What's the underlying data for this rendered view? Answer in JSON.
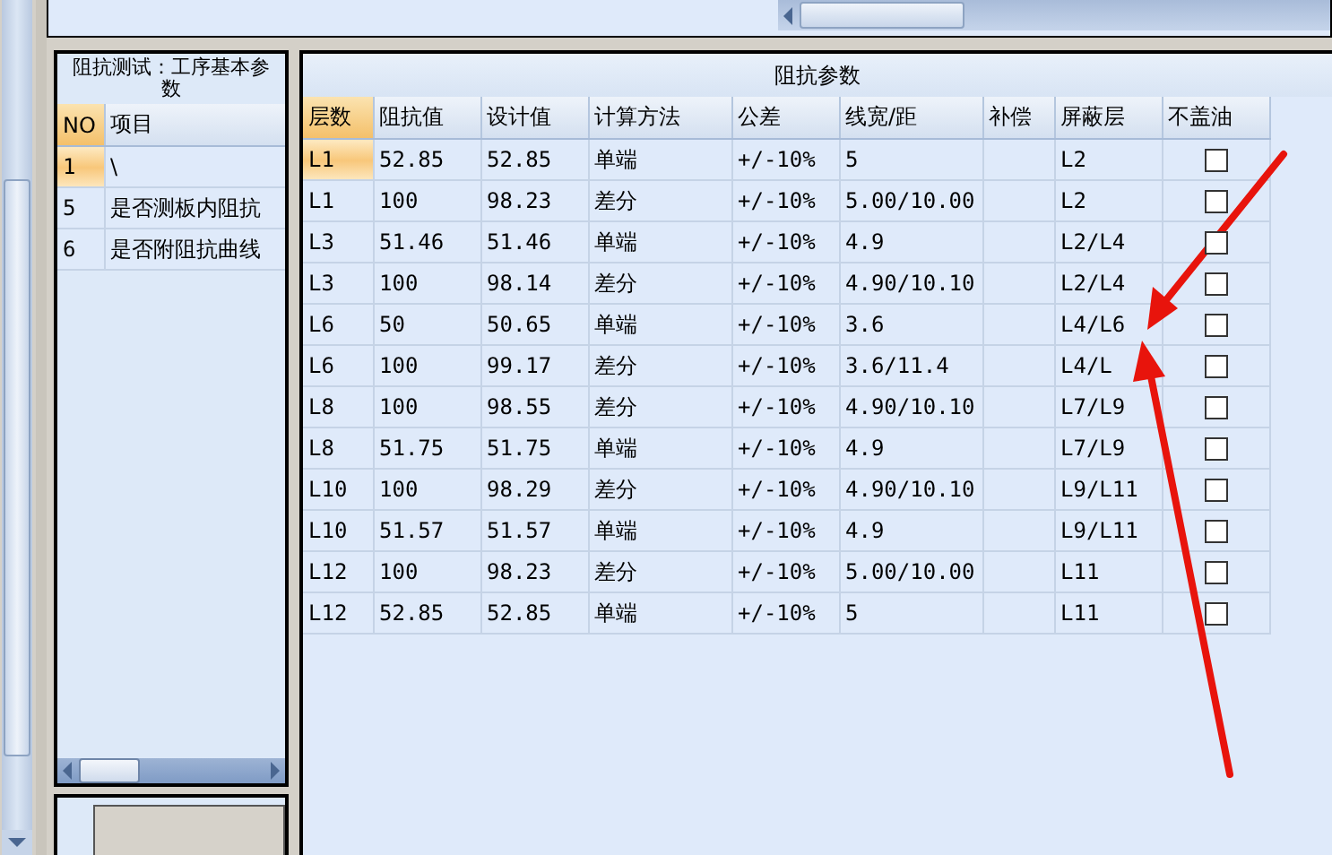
{
  "left_panel": {
    "title": "阻抗测试：工序基本参数",
    "columns": [
      "NO",
      "项目"
    ],
    "rows": [
      {
        "no": "1",
        "item": "\\",
        "selected": true
      },
      {
        "no": "5",
        "item": "是否测板内阻抗",
        "selected": false
      },
      {
        "no": "6",
        "item": "是否附阻抗曲线",
        "selected": false
      }
    ]
  },
  "impedance_table": {
    "title": "阻抗参数",
    "columns": [
      "层数",
      "阻抗值",
      "设计值",
      "计算方法",
      "公差",
      "线宽/距",
      "补偿",
      "屏蔽层",
      "不盖油"
    ],
    "rows": [
      {
        "cells": [
          "L1",
          "52.85",
          "52.85",
          "单端",
          "+/-10%",
          "5",
          "",
          "L2"
        ],
        "checked": false,
        "selected": true
      },
      {
        "cells": [
          "L1",
          "100",
          "98.23",
          "差分",
          "+/-10%",
          "5.00/10.00",
          "",
          "L2"
        ],
        "checked": false,
        "selected": false
      },
      {
        "cells": [
          "L3",
          "51.46",
          "51.46",
          "单端",
          "+/-10%",
          "4.9",
          "",
          "L2/L4"
        ],
        "checked": false,
        "selected": false
      },
      {
        "cells": [
          "L3",
          "100",
          "98.14",
          "差分",
          "+/-10%",
          "4.90/10.10",
          "",
          "L2/L4"
        ],
        "checked": false,
        "selected": false
      },
      {
        "cells": [
          "L6",
          "50",
          "50.65",
          "单端",
          "+/-10%",
          "3.6",
          "",
          "L4/L6"
        ],
        "checked": false,
        "selected": false
      },
      {
        "cells": [
          "L6",
          "100",
          "99.17",
          "差分",
          "+/-10%",
          "3.6/11.4",
          "",
          "L4/L"
        ],
        "checked": false,
        "selected": false
      },
      {
        "cells": [
          "L8",
          "100",
          "98.55",
          "差分",
          "+/-10%",
          "4.90/10.10",
          "",
          "L7/L9"
        ],
        "checked": false,
        "selected": false
      },
      {
        "cells": [
          "L8",
          "51.75",
          "51.75",
          "单端",
          "+/-10%",
          "4.9",
          "",
          "L7/L9"
        ],
        "checked": false,
        "selected": false
      },
      {
        "cells": [
          "L10",
          "100",
          "98.29",
          "差分",
          "+/-10%",
          "4.90/10.10",
          "",
          "L9/L11"
        ],
        "checked": false,
        "selected": false
      },
      {
        "cells": [
          "L10",
          "51.57",
          "51.57",
          "单端",
          "+/-10%",
          "4.9",
          "",
          "L9/L11"
        ],
        "checked": false,
        "selected": false
      },
      {
        "cells": [
          "L12",
          "100",
          "98.23",
          "差分",
          "+/-10%",
          "5.00/10.00",
          "",
          "L11"
        ],
        "checked": false,
        "selected": false
      },
      {
        "cells": [
          "L12",
          "52.85",
          "52.85",
          "单端",
          "+/-10%",
          "5",
          "",
          "L11"
        ],
        "checked": false,
        "selected": false
      }
    ]
  }
}
